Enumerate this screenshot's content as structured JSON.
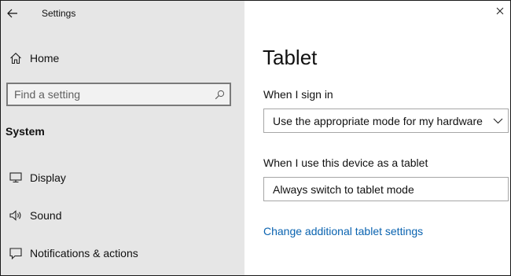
{
  "window": {
    "title": "Settings"
  },
  "sidebar": {
    "home_label": "Home",
    "search": {
      "placeholder": "Find a setting"
    },
    "section_header": "System",
    "items": [
      {
        "label": "Display",
        "icon": "monitor-icon"
      },
      {
        "label": "Sound",
        "icon": "speaker-icon"
      },
      {
        "label": "Notifications & actions",
        "icon": "message-icon"
      }
    ]
  },
  "main": {
    "title": "Tablet",
    "sign_in": {
      "label": "When I sign in",
      "selected": "Use the appropriate mode for my hardware"
    },
    "tablet_use": {
      "label": "When I use this device as a tablet",
      "selected": "Always switch to tablet mode"
    },
    "link_label": "Change additional tablet settings"
  },
  "colors": {
    "sidebar_bg": "#e6e6e6",
    "link": "#0a63b0",
    "border": "#a6a6a6"
  }
}
